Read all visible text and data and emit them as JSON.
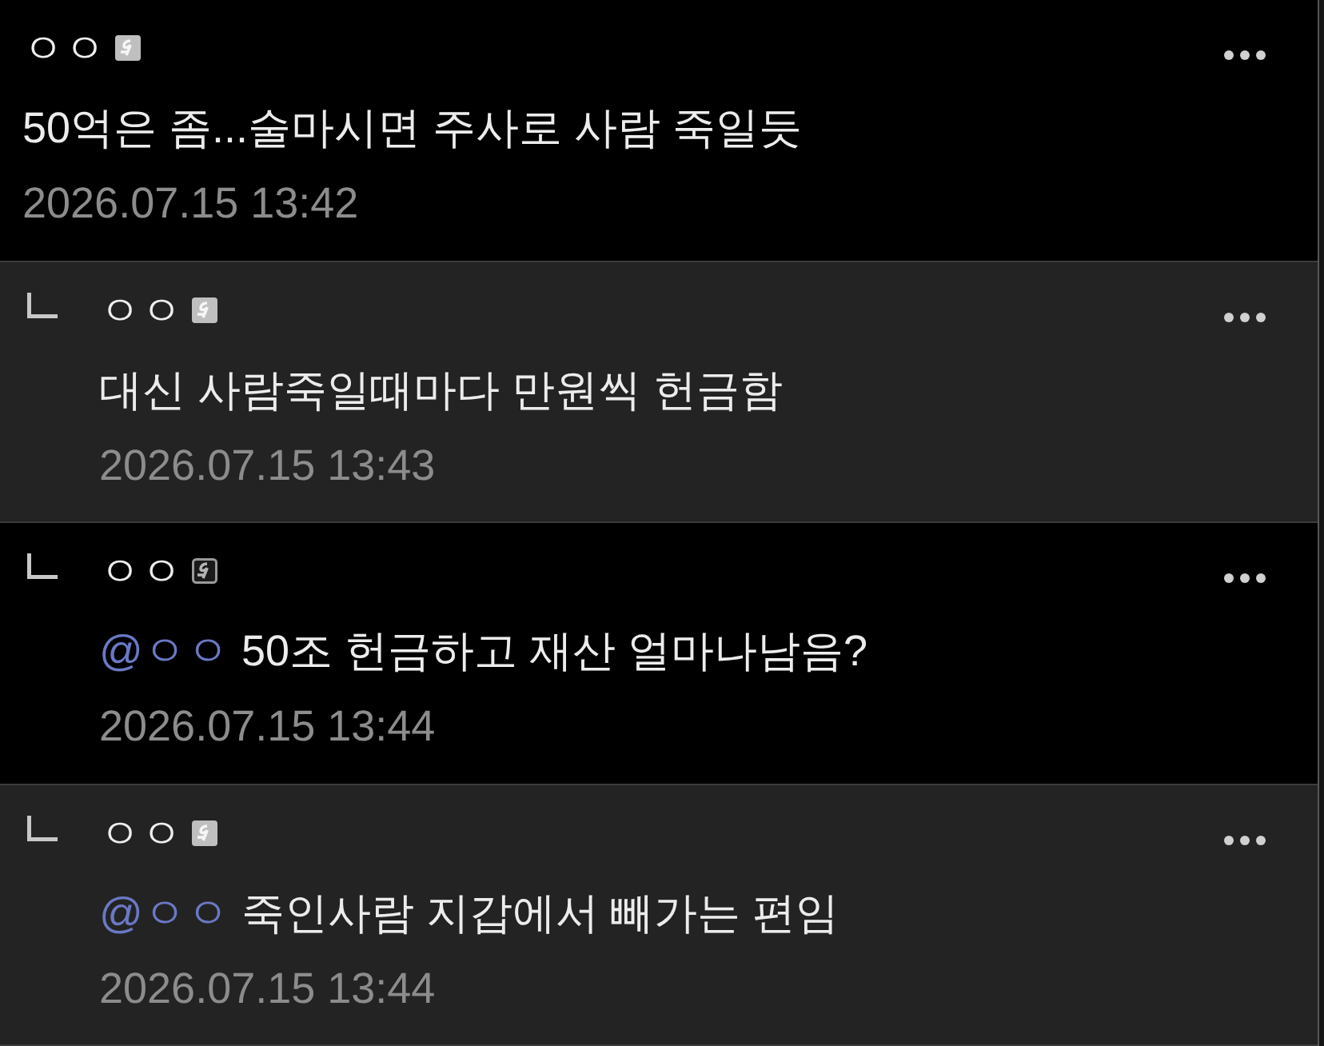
{
  "comments": [
    {
      "kind": "comment",
      "shaded": false,
      "author": "ㅇㅇ",
      "badge": {
        "kind": "filled"
      },
      "text": "50억은 좀...술마시면 주사로 사람 죽일듯",
      "date": "2026.07.15 13:42"
    },
    {
      "kind": "reply",
      "shaded": true,
      "author": "ㅇㅇ",
      "badge": {
        "kind": "filled"
      },
      "text": "대신 사람죽일때마다 만원씩 헌금함",
      "date": "2026.07.15 13:43"
    },
    {
      "kind": "reply",
      "shaded": false,
      "author": "ㅇㅇ",
      "badge": {
        "kind": "outlined"
      },
      "mention": "@ㅇㅇ",
      "text": "50조 헌금하고 재산 얼마나남음?",
      "date": "2026.07.15 13:44"
    },
    {
      "kind": "reply",
      "shaded": true,
      "author": "ㅇㅇ",
      "badge": {
        "kind": "filled"
      },
      "mention": "@ㅇㅇ",
      "text": "죽인사람 지갑에서 빼가는 편임",
      "date": "2026.07.15 13:44"
    }
  ]
}
